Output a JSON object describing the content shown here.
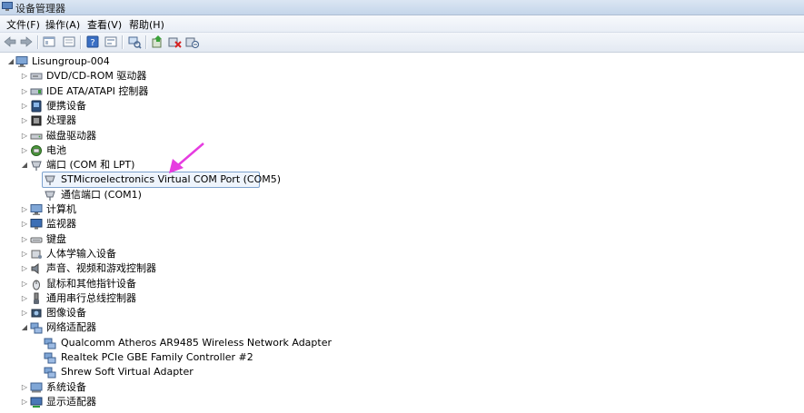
{
  "window": {
    "title": "设备管理器"
  },
  "menu": [
    "文件(F)",
    "操作(A)",
    "查看(V)",
    "帮助(H)"
  ],
  "toolbar_icons": [
    "back-icon",
    "forward-icon",
    "properties-icon",
    "view-icon",
    "help-icon",
    "toggle-icon",
    "scan-hardware-icon",
    "update-driver-icon",
    "uninstall-icon",
    "disable-icon"
  ],
  "tree": [
    {
      "label": "Lisungroup-004",
      "level": 0,
      "expander": "open",
      "icon": "computer-icon"
    },
    {
      "label": "DVD/CD-ROM 驱动器",
      "level": 1,
      "expander": "closed",
      "icon": "dvd-icon"
    },
    {
      "label": "IDE ATA/ATAPI 控制器",
      "level": 1,
      "expander": "closed",
      "icon": "ide-icon"
    },
    {
      "label": "便携设备",
      "level": 1,
      "expander": "closed",
      "icon": "portable-icon"
    },
    {
      "label": "处理器",
      "level": 1,
      "expander": "closed",
      "icon": "processor-icon"
    },
    {
      "label": "磁盘驱动器",
      "level": 1,
      "expander": "closed",
      "icon": "disk-icon"
    },
    {
      "label": "电池",
      "level": 1,
      "expander": "closed",
      "icon": "battery-icon"
    },
    {
      "label": "端口 (COM 和 LPT)",
      "level": 1,
      "expander": "open",
      "icon": "port-icon"
    },
    {
      "label": "STMicroelectronics Virtual COM Port (COM5)",
      "level": 2,
      "expander": "none",
      "icon": "port-icon",
      "selected": true
    },
    {
      "label": "通信端口 (COM1)",
      "level": 2,
      "expander": "none",
      "icon": "port-icon"
    },
    {
      "label": "计算机",
      "level": 1,
      "expander": "closed",
      "icon": "computer-icon"
    },
    {
      "label": "监视器",
      "level": 1,
      "expander": "closed",
      "icon": "monitor-icon"
    },
    {
      "label": "键盘",
      "level": 1,
      "expander": "closed",
      "icon": "keyboard-icon"
    },
    {
      "label": "人体学输入设备",
      "level": 1,
      "expander": "closed",
      "icon": "hid-icon"
    },
    {
      "label": "声音、视频和游戏控制器",
      "level": 1,
      "expander": "closed",
      "icon": "sound-icon"
    },
    {
      "label": "鼠标和其他指针设备",
      "level": 1,
      "expander": "closed",
      "icon": "mouse-icon"
    },
    {
      "label": "通用串行总线控制器",
      "level": 1,
      "expander": "closed",
      "icon": "usb-icon"
    },
    {
      "label": "图像设备",
      "level": 1,
      "expander": "closed",
      "icon": "camera-icon"
    },
    {
      "label": "网络适配器",
      "level": 1,
      "expander": "open",
      "icon": "network-icon"
    },
    {
      "label": "Qualcomm Atheros AR9485 Wireless Network Adapter",
      "level": 2,
      "expander": "none",
      "icon": "network-icon"
    },
    {
      "label": "Realtek PCIe GBE Family Controller #2",
      "level": 2,
      "expander": "none",
      "icon": "network-icon"
    },
    {
      "label": "Shrew Soft Virtual Adapter",
      "level": 2,
      "expander": "none",
      "icon": "network-icon"
    },
    {
      "label": "系统设备",
      "level": 1,
      "expander": "closed",
      "icon": "system-icon"
    },
    {
      "label": "显示适配器",
      "level": 1,
      "expander": "closed",
      "icon": "display-icon"
    }
  ],
  "colors": {
    "annotation_arrow": "#e63ce0",
    "selection_border": "#7da2ce"
  }
}
